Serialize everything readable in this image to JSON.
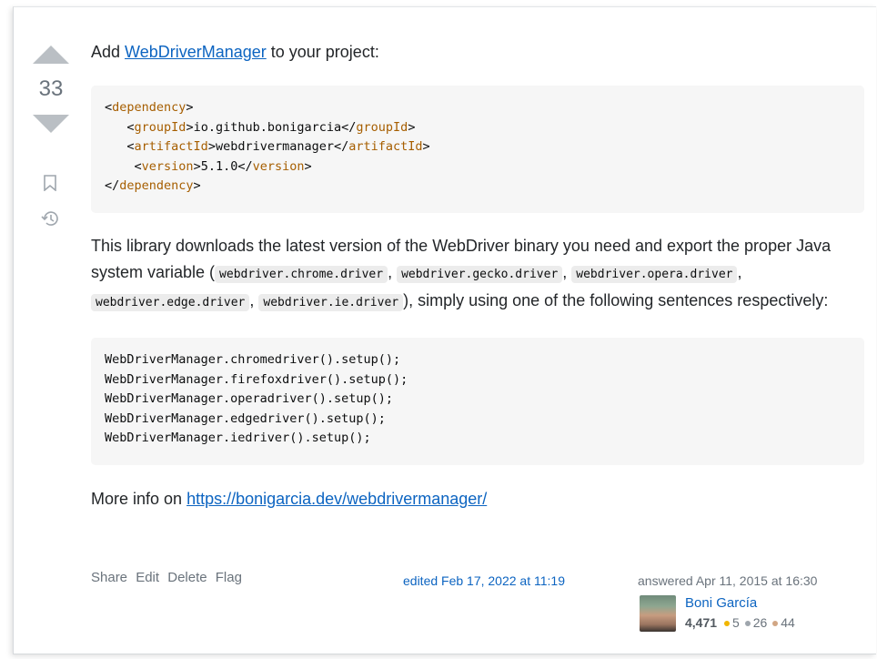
{
  "vote": {
    "score": "33"
  },
  "intro": {
    "prefix": "Add ",
    "link_text": "WebDriverManager",
    "suffix": " to your project:"
  },
  "code_block_1": {
    "lines": [
      {
        "indent": "",
        "open": "dependency",
        "text": "",
        "close": ""
      },
      {
        "indent": "   ",
        "open": "groupId",
        "text": "io.github.bonigarcia",
        "close": "groupId"
      },
      {
        "indent": "   ",
        "open": "artifactId",
        "text": "webdrivermanager",
        "close": "artifactId"
      },
      {
        "indent": "    ",
        "open": "version",
        "text": "5.1.0",
        "close": "version"
      },
      {
        "indent": "",
        "open": "",
        "text": "",
        "close": "dependency"
      }
    ]
  },
  "description": {
    "part1": "This library downloads the latest version of the WebDriver binary you need and export the proper Java system variable (",
    "codes": [
      "webdriver.chrome.driver",
      "webdriver.gecko.driver",
      "webdriver.opera.driver",
      "webdriver.edge.driver",
      "webdriver.ie.driver"
    ],
    "sep": ", ",
    "part2": "), simply using one of the following sentences respectively:"
  },
  "code_block_2": {
    "lines": [
      "WebDriverManager.chromedriver().setup();",
      "WebDriverManager.firefoxdriver().setup();",
      "WebDriverManager.operadriver().setup();",
      "WebDriverManager.edgedriver().setup();",
      "WebDriverManager.iedriver().setup();"
    ]
  },
  "more_info": {
    "prefix": "More info on ",
    "link_text": "https://bonigarcia.dev/webdrivermanager/"
  },
  "post_menu": {
    "share": "Share",
    "edit": "Edit",
    "delete": "Delete",
    "flag": "Flag"
  },
  "edited": "edited Feb 17, 2022 at 11:19",
  "answered": "answered Apr 11, 2015 at 16:30",
  "user": {
    "name": "Boni García",
    "reputation": "4,471",
    "gold": "5",
    "silver": "26",
    "bronze": "44"
  },
  "colors": {
    "gold": "#f1b600",
    "silver": "#9fa6ad",
    "bronze": "#d1a684",
    "link": "#0c64c1",
    "tag": "#a65e00"
  },
  "icons": [
    "vote-up-icon",
    "vote-down-icon",
    "bookmark-icon",
    "history-icon"
  ]
}
